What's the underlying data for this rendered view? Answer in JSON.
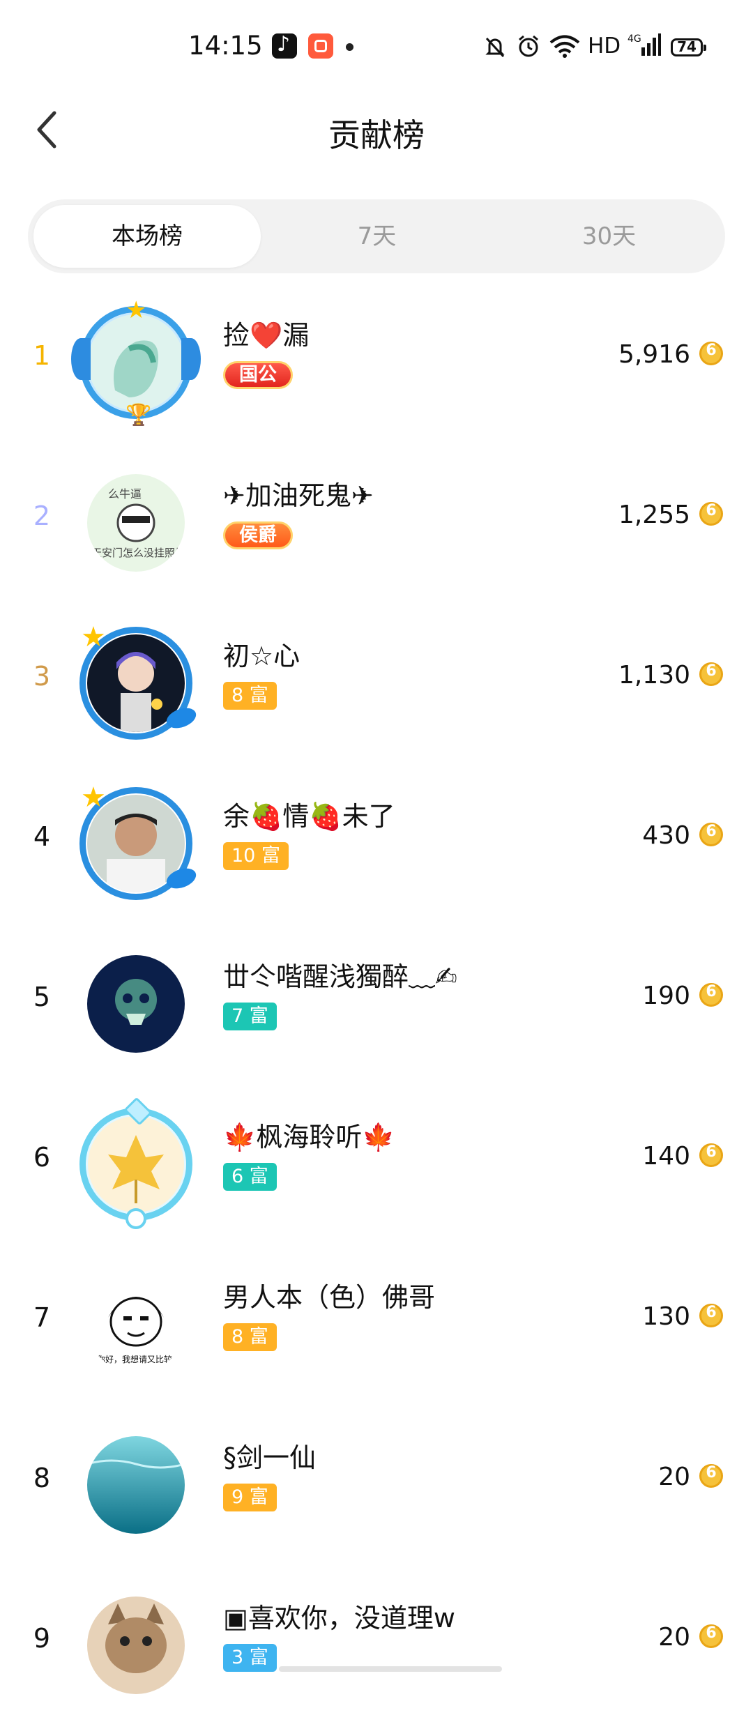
{
  "status_bar": {
    "time": "14:15",
    "network": "HD",
    "cellular": "4G",
    "battery": "74"
  },
  "header": {
    "title": "贡献榜",
    "back_icon": "chevron-left-icon"
  },
  "tabs": [
    {
      "label": "本场榜",
      "active": true
    },
    {
      "label": "7天",
      "active": false
    },
    {
      "label": "30天",
      "active": false
    }
  ],
  "colors": {
    "rank1": "#f5b400",
    "rank2": "#a9b0ff",
    "rank3": "#d09a4a",
    "badge_orange": "#ffb124",
    "badge_teal": "#1cc6b4",
    "coin": "#f6c23a"
  },
  "rankings": [
    {
      "rank": "1",
      "name": "捡❤️漏",
      "badge": "国公",
      "score": "5,916"
    },
    {
      "rank": "2",
      "name": "✈加油死鬼✈",
      "badge": "侯爵",
      "score": "1,255"
    },
    {
      "rank": "3",
      "name": "初☆心",
      "badge": "8 富",
      "score": "1,130"
    },
    {
      "rank": "4",
      "name": "余🍓情🍓未了",
      "badge": "10 富",
      "score": "430"
    },
    {
      "rank": "5",
      "name": "丗仒喈醒浅獨醉﹏✍",
      "badge": "7 富",
      "score": "190"
    },
    {
      "rank": "6",
      "name": "🍁枫海聆听🍁",
      "badge": "6 富",
      "score": "140"
    },
    {
      "rank": "7",
      "name": "男人本（色）佛哥",
      "badge": "8 富",
      "score": "130"
    },
    {
      "rank": "8",
      "name": "§剑一仙",
      "badge": "9 富",
      "score": "20"
    },
    {
      "rank": "9",
      "name": "▣喜欢你，没道理w",
      "badge": "3 富",
      "score": "20"
    }
  ],
  "avatar_texts": {
    "rank2_top": "么牛逼",
    "rank2_bottom": "天安门怎么没挂照片",
    "rank7_caption": "你好，我想请又比较"
  }
}
